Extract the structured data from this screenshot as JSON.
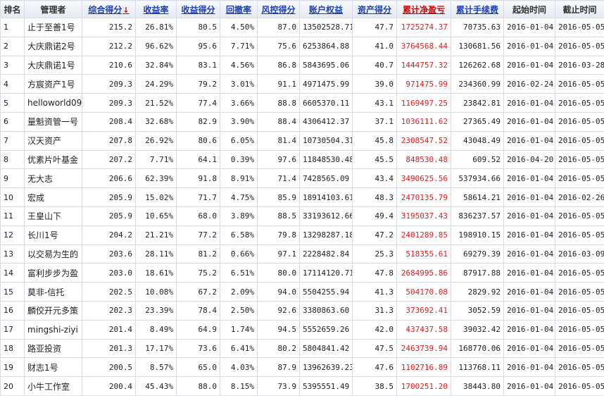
{
  "headers": {
    "rank": "排名",
    "manager": "管理者",
    "composite": "综合得分",
    "return_rate": "收益率",
    "return_score": "收益得分",
    "drawdown": "回撤率",
    "risk_score": "风控得分",
    "equity": "账户权益",
    "asset_score": "资产得分",
    "cum_profit": "累计净盈亏",
    "cum_fee": "累计手续费",
    "start": "起始时间",
    "end": "截止时间"
  },
  "sort_icon": "arrow-down-icon",
  "colors": {
    "link": "#1a3fb8",
    "accent_red": "#d40000",
    "profit": "#e02020",
    "border": "#d6dbe4"
  },
  "rows": [
    {
      "rank": "1",
      "manager": "止于至善1号",
      "composite": "215.2",
      "return_rate": "26.81%",
      "return_score": "80.5",
      "drawdown": "4.50%",
      "risk_score": "87.0",
      "equity": "13502528.71",
      "asset_score": "47.7",
      "cum_profit": "1725274.37",
      "cum_fee": "70735.63",
      "start": "2016-01-04",
      "end": "2016-05-05"
    },
    {
      "rank": "2",
      "manager": "大庆鼎诺2号",
      "composite": "212.2",
      "return_rate": "96.62%",
      "return_score": "95.6",
      "drawdown": "7.71%",
      "risk_score": "75.6",
      "equity": "6253864.88",
      "asset_score": "41.0",
      "cum_profit": "3764568.44",
      "cum_fee": "130681.56",
      "start": "2016-01-04",
      "end": "2016-05-05"
    },
    {
      "rank": "3",
      "manager": "大庆鼎诺1号",
      "composite": "210.6",
      "return_rate": "32.84%",
      "return_score": "83.1",
      "drawdown": "4.56%",
      "risk_score": "86.8",
      "equity": "5843695.06",
      "asset_score": "40.7",
      "cum_profit": "1444757.32",
      "cum_fee": "126262.68",
      "start": "2016-01-04",
      "end": "2016-03-28"
    },
    {
      "rank": "4",
      "manager": "方宸资产1号",
      "composite": "209.3",
      "return_rate": "24.29%",
      "return_score": "79.2",
      "drawdown": "3.01%",
      "risk_score": "91.1",
      "equity": "4971475.99",
      "asset_score": "39.0",
      "cum_profit": "971475.99",
      "cum_fee": "234360.99",
      "start": "2016-02-24",
      "end": "2016-05-05"
    },
    {
      "rank": "5",
      "manager": "helloworld09",
      "composite": "209.3",
      "return_rate": "21.52%",
      "return_score": "77.4",
      "drawdown": "3.66%",
      "risk_score": "88.8",
      "equity": "6605370.11",
      "asset_score": "43.1",
      "cum_profit": "1169497.25",
      "cum_fee": "23842.81",
      "start": "2016-01-04",
      "end": "2016-05-05"
    },
    {
      "rank": "6",
      "manager": "量魁资管一号",
      "composite": "208.4",
      "return_rate": "32.68%",
      "return_score": "82.9",
      "drawdown": "3.90%",
      "risk_score": "88.4",
      "equity": "4306412.37",
      "asset_score": "37.1",
      "cum_profit": "1036111.62",
      "cum_fee": "27365.49",
      "start": "2016-01-04",
      "end": "2016-05-05"
    },
    {
      "rank": "7",
      "manager": "汉天资产",
      "composite": "207.8",
      "return_rate": "26.92%",
      "return_score": "80.6",
      "drawdown": "6.05%",
      "risk_score": "81.4",
      "equity": "10730504.31",
      "asset_score": "45.8",
      "cum_profit": "2308547.52",
      "cum_fee": "43048.49",
      "start": "2016-01-04",
      "end": "2016-05-05"
    },
    {
      "rank": "8",
      "manager": "优素片叶基金",
      "composite": "207.2",
      "return_rate": "7.71%",
      "return_score": "64.1",
      "drawdown": "0.39%",
      "risk_score": "97.6",
      "equity": "11848530.48",
      "asset_score": "45.5",
      "cum_profit": "848530.48",
      "cum_fee": "609.52",
      "start": "2016-04-20",
      "end": "2016-05-05"
    },
    {
      "rank": "9",
      "manager": "无大志",
      "composite": "206.6",
      "return_rate": "62.39%",
      "return_score": "91.8",
      "drawdown": "8.91%",
      "risk_score": "71.4",
      "equity": "7428565.09",
      "asset_score": "43.4",
      "cum_profit": "3490625.56",
      "cum_fee": "537934.66",
      "start": "2016-01-04",
      "end": "2016-05-05"
    },
    {
      "rank": "10",
      "manager": "宏成",
      "composite": "205.9",
      "return_rate": "15.02%",
      "return_score": "71.7",
      "drawdown": "4.75%",
      "risk_score": "85.9",
      "equity": "18914103.61",
      "asset_score": "48.3",
      "cum_profit": "2470135.79",
      "cum_fee": "58614.21",
      "start": "2016-01-04",
      "end": "2016-02-26"
    },
    {
      "rank": "11",
      "manager": "王皇山下",
      "composite": "205.9",
      "return_rate": "10.65%",
      "return_score": "68.0",
      "drawdown": "3.89%",
      "risk_score": "88.5",
      "equity": "33193612.66",
      "asset_score": "49.4",
      "cum_profit": "3195037.43",
      "cum_fee": "836237.57",
      "start": "2016-01-04",
      "end": "2016-05-05"
    },
    {
      "rank": "12",
      "manager": "长川1号",
      "composite": "204.2",
      "return_rate": "21.21%",
      "return_score": "77.2",
      "drawdown": "6.58%",
      "risk_score": "79.8",
      "equity": "13298287.18",
      "asset_score": "47.2",
      "cum_profit": "2401289.85",
      "cum_fee": "198910.15",
      "start": "2016-01-04",
      "end": "2016-05-05"
    },
    {
      "rank": "13",
      "manager": "以交易为生的",
      "composite": "203.6",
      "return_rate": "28.11%",
      "return_score": "81.2",
      "drawdown": "0.66%",
      "risk_score": "97.1",
      "equity": "2228482.84",
      "asset_score": "25.3",
      "cum_profit": "518355.61",
      "cum_fee": "69279.39",
      "start": "2016-01-04",
      "end": "2016-03-09"
    },
    {
      "rank": "14",
      "manager": "富利步步为盈",
      "composite": "203.0",
      "return_rate": "18.61%",
      "return_score": "75.2",
      "drawdown": "6.51%",
      "risk_score": "80.0",
      "equity": "17114120.71",
      "asset_score": "47.8",
      "cum_profit": "2684995.86",
      "cum_fee": "87917.88",
      "start": "2016-01-04",
      "end": "2016-05-05"
    },
    {
      "rank": "15",
      "manager": "莫非-信托",
      "composite": "202.5",
      "return_rate": "10.08%",
      "return_score": "67.2",
      "drawdown": "2.09%",
      "risk_score": "94.0",
      "equity": "5504255.94",
      "asset_score": "41.3",
      "cum_profit": "504170.08",
      "cum_fee": "2829.92",
      "start": "2016-01-04",
      "end": "2016-05-05"
    },
    {
      "rank": "16",
      "manager": "麟佼开元多策",
      "composite": "202.3",
      "return_rate": "23.39%",
      "return_score": "78.4",
      "drawdown": "2.50%",
      "risk_score": "92.6",
      "equity": "3380863.60",
      "asset_score": "31.3",
      "cum_profit": "373692.41",
      "cum_fee": "3052.59",
      "start": "2016-01-04",
      "end": "2016-05-05"
    },
    {
      "rank": "17",
      "manager": "mingshi-ziyi",
      "composite": "201.4",
      "return_rate": "8.49%",
      "return_score": "64.9",
      "drawdown": "1.74%",
      "risk_score": "94.5",
      "equity": "5552659.26",
      "asset_score": "42.0",
      "cum_profit": "437437.58",
      "cum_fee": "39032.42",
      "start": "2016-01-04",
      "end": "2016-05-05"
    },
    {
      "rank": "18",
      "manager": "路亚投资",
      "composite": "201.3",
      "return_rate": "17.17%",
      "return_score": "73.6",
      "drawdown": "6.41%",
      "risk_score": "80.2",
      "equity": "5804841.42",
      "asset_score": "47.5",
      "cum_profit": "2463739.94",
      "cum_fee": "168770.06",
      "start": "2016-01-04",
      "end": "2016-05-05"
    },
    {
      "rank": "19",
      "manager": "财志1号",
      "composite": "200.5",
      "return_rate": "8.57%",
      "return_score": "65.0",
      "drawdown": "4.03%",
      "risk_score": "87.9",
      "equity": "13962639.23",
      "asset_score": "47.6",
      "cum_profit": "1102716.89",
      "cum_fee": "113768.11",
      "start": "2016-01-04",
      "end": "2016-05-05"
    },
    {
      "rank": "20",
      "manager": "小牛工作室",
      "composite": "200.4",
      "return_rate": "45.43%",
      "return_score": "88.0",
      "drawdown": "8.15%",
      "risk_score": "73.9",
      "equity": "5395551.49",
      "asset_score": "38.5",
      "cum_profit": "1700251.20",
      "cum_fee": "38443.80",
      "start": "2016-01-04",
      "end": "2016-05-05"
    }
  ]
}
